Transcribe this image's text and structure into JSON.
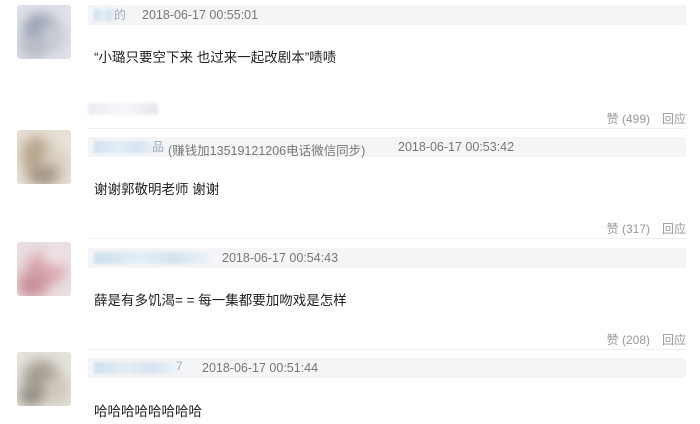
{
  "comments": [
    {
      "username_tail": "的",
      "timestamp": "2018-06-17 00:55:01",
      "text": "“小璐只要空下来 也过来一起改剧本”啧啧",
      "like_label": "赞",
      "like_count": "(499)",
      "reply_label": "回应"
    },
    {
      "username_tail": "品",
      "user_note": "(赚钱加13519121206电话微信同步)",
      "timestamp": "2018-06-17 00:53:42",
      "text": "谢谢郭敬明老师 谢谢",
      "like_label": "赞",
      "like_count": "(317)",
      "reply_label": "回应"
    },
    {
      "username_tail": "",
      "timestamp": "2018-06-17 00:54:43",
      "text": "薛是有多饥渴= = 每一集都要加吻戏是怎样",
      "like_label": "赞",
      "like_count": "(208)",
      "reply_label": "回应"
    },
    {
      "username_tail": "7",
      "timestamp": "2018-06-17 00:51:44",
      "text": "哈哈哈哈哈哈哈哈"
    }
  ]
}
